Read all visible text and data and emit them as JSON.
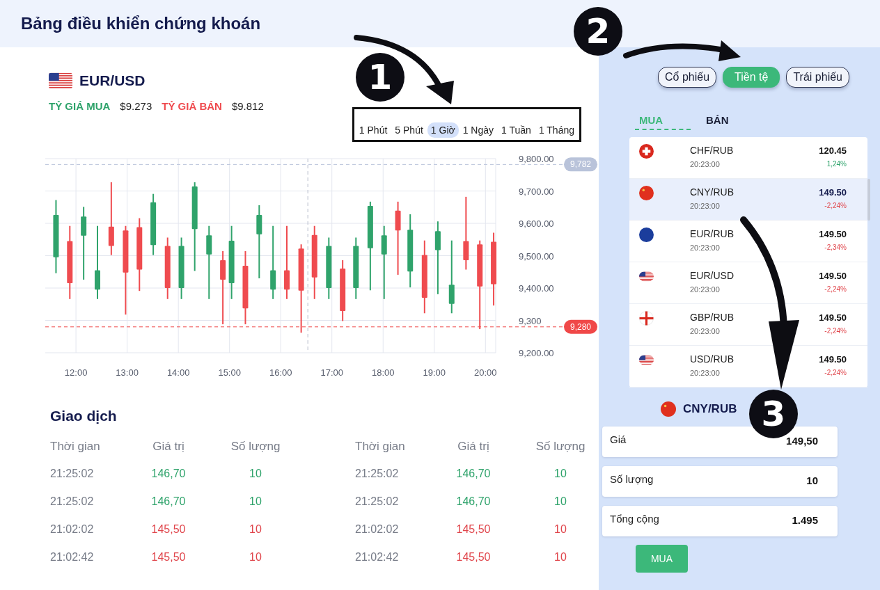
{
  "title": "Bảng điều khiển chứng khoán",
  "pair": {
    "kind": "us",
    "name": "EUR/USD",
    "buy_label": "TỶ GIÁ MUA",
    "buy_value": "$9.273",
    "sell_label": "TỶ GIÁ BÁN",
    "sell_value": "$9.812"
  },
  "timeframes": [
    {
      "label": "1 Phút",
      "selected": false
    },
    {
      "label": "5 Phút",
      "selected": false
    },
    {
      "label": "1 Giờ",
      "selected": true
    },
    {
      "label": "1 Ngày",
      "selected": false
    },
    {
      "label": "1 Tuần",
      "selected": false
    },
    {
      "label": "1 Tháng",
      "selected": false
    }
  ],
  "chart_data": {
    "type": "candlestick",
    "grid": true,
    "x": [
      11.61,
      11.88,
      12.15,
      12.42,
      12.69,
      12.97,
      13.24,
      13.51,
      13.79,
      14.06,
      14.32,
      14.6,
      14.87,
      15.04,
      15.31,
      15.58,
      15.85,
      16.12,
      16.4,
      16.66,
      16.94,
      17.21,
      17.47,
      17.75,
      18.02,
      18.29,
      18.53,
      18.81,
      19.07,
      19.34,
      19.62,
      19.89,
      20.16
    ],
    "ohlc": [
      [
        9495,
        9672,
        9446,
        9626
      ],
      [
        9545,
        9592,
        9366,
        9415
      ],
      [
        9562,
        9651,
        9426,
        9621
      ],
      [
        9395,
        9592,
        9366,
        9455
      ],
      [
        9590,
        9727,
        9502,
        9530
      ],
      [
        9578,
        9592,
        9318,
        9448
      ],
      [
        9588,
        9616,
        9391,
        9457
      ],
      [
        9533,
        9691,
        9502,
        9665
      ],
      [
        9530,
        9556,
        9366,
        9400
      ],
      [
        9400,
        9556,
        9366,
        9530
      ],
      [
        9582,
        9727,
        9453,
        9714
      ],
      [
        9504,
        9592,
        9366,
        9563
      ],
      [
        9486,
        9514,
        9288,
        9426
      ],
      [
        9415,
        9592,
        9366,
        9546
      ],
      [
        9469,
        9514,
        9288,
        9337
      ],
      [
        9566,
        9656,
        9430,
        9626
      ],
      [
        9395,
        9592,
        9366,
        9455
      ],
      [
        9455,
        9592,
        9366,
        9395
      ],
      [
        9522,
        9535,
        9262,
        9392
      ],
      [
        9564,
        9592,
        9366,
        9433
      ],
      [
        9400,
        9556,
        9366,
        9530
      ],
      [
        9460,
        9486,
        9298,
        9329
      ],
      [
        9400,
        9556,
        9366,
        9530
      ],
      [
        9523,
        9667,
        9393,
        9654
      ],
      [
        9504,
        9592,
        9366,
        9563
      ],
      [
        9639,
        9667,
        9441,
        9578
      ],
      [
        9451,
        9628,
        9402,
        9580
      ],
      [
        9502,
        9547,
        9322,
        9370
      ],
      [
        9517,
        9606,
        9381,
        9576
      ],
      [
        9351,
        9547,
        9322,
        9410
      ],
      [
        9545,
        9682,
        9457,
        9486
      ],
      [
        9535,
        9547,
        9273,
        9405
      ],
      [
        9543,
        9571,
        9346,
        9412
      ]
    ],
    "xlim": [
      11.4,
      20.2
    ],
    "ylim": [
      9200,
      9800
    ],
    "xticks": [
      {
        "value": 12,
        "label": "12:00"
      },
      {
        "value": 13,
        "label": "13:00"
      },
      {
        "value": 14,
        "label": "14:00"
      },
      {
        "value": 15,
        "label": "15:00"
      },
      {
        "value": 16,
        "label": "16:00"
      },
      {
        "value": 17,
        "label": "17:00"
      },
      {
        "value": 18,
        "label": "18:00"
      },
      {
        "value": 19,
        "label": "19:00"
      },
      {
        "value": 20,
        "label": "20:00"
      }
    ],
    "yticks": [
      {
        "value": 9800,
        "label": "9,800.00"
      },
      {
        "value": 9700,
        "label": "9,700.00"
      },
      {
        "value": 9600,
        "label": "9,600.00"
      },
      {
        "value": 9500,
        "label": "9,500.00"
      },
      {
        "value": 9400,
        "label": "9,400.00"
      },
      {
        "value": 9300,
        "label": "9,300"
      },
      {
        "value": 9200,
        "label": "9,200.00"
      }
    ],
    "ref_lines": [
      {
        "axis": "y",
        "value": 9782,
        "label": "9,782",
        "color": "#b9c3da"
      },
      {
        "axis": "y",
        "value": 9280,
        "label": "9,280",
        "color": "#f04848"
      },
      {
        "axis": "x",
        "value": 16.53,
        "color": "#b7bccb"
      }
    ]
  },
  "trades": {
    "title": "Giao dịch",
    "tables": [
      {
        "columns": [
          "Thời gian",
          "Giá trị",
          "Số lượng"
        ],
        "rows": [
          {
            "time": "21:25:02",
            "value": "146,70",
            "qty": "10",
            "color": "#2fa36b"
          },
          {
            "time": "21:25:02",
            "value": "146,70",
            "qty": "10",
            "color": "#2fa36b"
          },
          {
            "time": "21:02:02",
            "value": "145,50",
            "qty": "10",
            "color": "#e0454b"
          },
          {
            "time": "21:02:42",
            "value": "145,50",
            "qty": "10",
            "color": "#e0454b"
          }
        ]
      },
      {
        "columns": [
          "Thời gian",
          "Giá trị",
          "Số lượng"
        ],
        "rows": [
          {
            "time": "21:25:02",
            "value": "146,70",
            "qty": "10",
            "color": "#2fa36b"
          },
          {
            "time": "21:25:02",
            "value": "146,70",
            "qty": "10",
            "color": "#2fa36b"
          },
          {
            "time": "21:02:02",
            "value": "145,50",
            "qty": "10",
            "color": "#e0454b"
          },
          {
            "time": "21:02:42",
            "value": "145,50",
            "qty": "10",
            "color": "#e0454b"
          }
        ]
      }
    ]
  },
  "market_tabs": [
    {
      "label": "Cổ phiếu",
      "selected": false
    },
    {
      "label": "Tiền tệ",
      "selected": true
    },
    {
      "label": "Trái phiếu",
      "selected": false
    }
  ],
  "side_tabs": [
    {
      "label": "MUA",
      "selected": true
    },
    {
      "label": "BÁN",
      "selected": false
    }
  ],
  "quotes": [
    {
      "kind": "ch",
      "pair": "CHF/RUB",
      "time": "20:23:00",
      "price": "120.45",
      "change": "1,24%",
      "color": "#2fa36b",
      "selected": false
    },
    {
      "kind": "cn",
      "pair": "CNY/RUB",
      "time": "20:23:00",
      "price": "149.50",
      "change": "-2,24%",
      "color": "#e0454b",
      "selected": true
    },
    {
      "kind": "eu",
      "pair": "EUR/RUB",
      "time": "20:23:00",
      "price": "149.50",
      "change": "-2,34%",
      "color": "#e0454b",
      "selected": false
    },
    {
      "kind": "us",
      "pair": "EUR/USD",
      "time": "20:23:00",
      "price": "149.50",
      "change": "-2,24%",
      "color": "#e0454b",
      "selected": false
    },
    {
      "kind": "gb",
      "pair": "GBP/RUB",
      "time": "20:23:00",
      "price": "149.50",
      "change": "-2,24%",
      "color": "#e0454b",
      "selected": false
    },
    {
      "kind": "us",
      "pair": "USD/RUB",
      "time": "20:23:00",
      "price": "149.50",
      "change": "-2,24%",
      "color": "#e0454b",
      "selected": false
    }
  ],
  "order": {
    "kind": "cn",
    "pair": "CNY/RUB",
    "fields": [
      {
        "label": "Giá",
        "value": "149,50"
      },
      {
        "label": "Số lượng",
        "value": "10"
      },
      {
        "label": "Tổng cộng",
        "value": "1.495"
      }
    ],
    "button": "MUA"
  },
  "callouts": [
    {
      "label": "1"
    },
    {
      "label": "2"
    },
    {
      "label": "3"
    }
  ]
}
